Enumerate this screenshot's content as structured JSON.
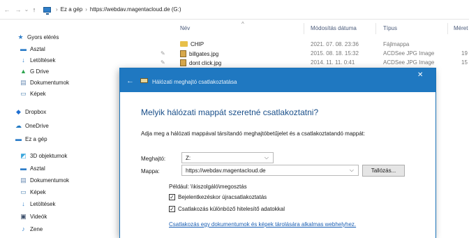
{
  "address": {
    "back": "←",
    "forward": "→",
    "up": "↑",
    "crumb_sep": "›",
    "crumbs": [
      "Ez a gép",
      "https://webdav.magentacloud.de (G:)"
    ]
  },
  "sidebar": {
    "items": [
      {
        "label": "Gyors elérés",
        "icon": "star-icon",
        "color": "#2f7ec9"
      },
      {
        "label": "Asztal",
        "icon": "desktop-icon",
        "color": "#2f7ec9"
      },
      {
        "label": "Letöltések",
        "icon": "download-icon",
        "color": "#2f7ec9"
      },
      {
        "label": "G Drive",
        "icon": "gdrive-icon",
        "color": "#2da44e"
      },
      {
        "label": "Dokumentumok",
        "icon": "documents-icon",
        "color": "#6b8db5"
      },
      {
        "label": "Képek",
        "icon": "pictures-icon",
        "color": "#4a7fb0"
      },
      {
        "label": "Dropbox",
        "icon": "dropbox-icon",
        "color": "#1f6fd1"
      },
      {
        "label": "OneDrive",
        "icon": "onedrive-icon",
        "color": "#1f78c1"
      },
      {
        "label": "Ez a gép",
        "icon": "computer-icon",
        "color": "#2f7ec9"
      },
      {
        "label": "3D objektumok",
        "icon": "3d-objects-icon",
        "color": "#3aa6dc"
      },
      {
        "label": "Asztal",
        "icon": "desktop-icon",
        "color": "#2f7ec9"
      },
      {
        "label": "Dokumentumok",
        "icon": "documents-icon",
        "color": "#6b8db5"
      },
      {
        "label": "Képek",
        "icon": "pictures-icon",
        "color": "#4a7fb0"
      },
      {
        "label": "Letöltések",
        "icon": "download-icon",
        "color": "#2f7ec9"
      },
      {
        "label": "Videók",
        "icon": "videos-icon",
        "color": "#3d4f6b"
      },
      {
        "label": "Zene",
        "icon": "music-icon",
        "color": "#2f7ec9"
      }
    ]
  },
  "files": {
    "columns": {
      "name": "Név",
      "modified": "Módosítás dátuma",
      "type": "Típus",
      "size": "Méret"
    },
    "rows": [
      {
        "name": "CHIP",
        "modified": "2021. 07. 08. 23:36",
        "type": "Fájlmappa",
        "size": "",
        "icon": "folder-icon"
      },
      {
        "name": "billgates.jpg",
        "modified": "2015. 08. 18. 15:32",
        "type": "ACDSee JPG Image",
        "size": "19",
        "icon": "image-file-icon"
      },
      {
        "name": "dont click.jpg",
        "modified": "2014. 11. 11. 0:41",
        "type": "ACDSee JPG Image",
        "size": "15",
        "icon": "image-file-icon"
      }
    ]
  },
  "dialog": {
    "back_icon": "←",
    "title": "Hálózati meghajtó csatlakoztatása",
    "close": "✕",
    "heading": "Melyik hálózati mappát szeretné csatlakoztatni?",
    "description": "Adja meg a hálózati mappával társítandó meghajtóbetűjelet és a csatlakoztatandó mappát:",
    "drive_label": "Meghajtó:",
    "drive_value": "Z:",
    "folder_label": "Mappa:",
    "folder_value": "https://webdav.magentacloud.de",
    "browse": "Tallózás...",
    "example": "Például: \\\\kiszolgáló\\megosztás",
    "reconnect_label": "Bejelentkezéskor újracsatlakoztatás",
    "reconnect_checked": true,
    "other_credentials_label": "Csatlakozás különböző hitelesítő adatokkal",
    "other_credentials_checked": true,
    "link": "Csatlakozás egy dokumentumok és képek tárolására alkalmas webhelyhez.",
    "accent": "#1f78c1"
  }
}
